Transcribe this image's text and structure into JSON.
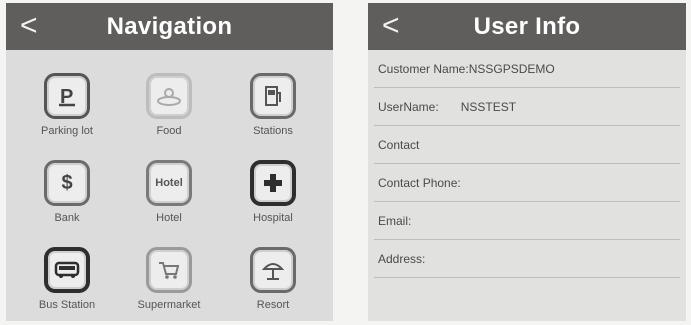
{
  "navigation": {
    "back_glyph": "<",
    "title": "Navigation",
    "items": [
      {
        "label": "Parking lot",
        "icon": "parking-icon"
      },
      {
        "label": "Food",
        "icon": "food-icon"
      },
      {
        "label": "Stations",
        "icon": "gas-station-icon"
      },
      {
        "label": "Bank",
        "icon": "dollar-icon"
      },
      {
        "label": "Hotel",
        "icon": "hotel-icon",
        "icon_text": "Hotel"
      },
      {
        "label": "Hospital",
        "icon": "plus-icon"
      },
      {
        "label": "Bus Station",
        "icon": "bus-icon"
      },
      {
        "label": "Supermarket",
        "icon": "cart-icon"
      },
      {
        "label": "Resort",
        "icon": "umbrella-icon"
      }
    ]
  },
  "user_info": {
    "back_glyph": "<",
    "title": "User Info",
    "fields": [
      {
        "label": "Customer Name:",
        "value": "NSSGPSDEMO"
      },
      {
        "label": "UserName:",
        "value": "NSSTEST"
      },
      {
        "label": "Contact",
        "value": ""
      },
      {
        "label": "Contact Phone:",
        "value": ""
      },
      {
        "label": "Email:",
        "value": ""
      },
      {
        "label": "Address:",
        "value": ""
      }
    ]
  }
}
